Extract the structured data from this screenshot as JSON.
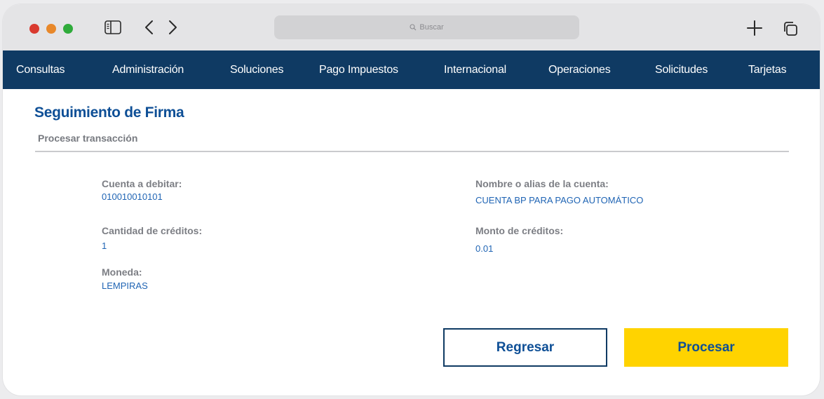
{
  "browser": {
    "search_placeholder": "Buscar"
  },
  "nav": {
    "items": [
      {
        "label": "Consultas"
      },
      {
        "label": "Administración"
      },
      {
        "label": "Soluciones"
      },
      {
        "label": "Pago Impuestos"
      },
      {
        "label": "Internacional"
      },
      {
        "label": "Operaciones"
      },
      {
        "label": "Solicitudes"
      },
      {
        "label": "Tarjetas"
      }
    ]
  },
  "page": {
    "title": "Seguimiento de Firma",
    "subtitle": "Procesar transacción"
  },
  "fields": {
    "cuenta_debitar": {
      "label": "Cuenta a debitar:",
      "value": "010010010101"
    },
    "nombre_alias": {
      "label": "Nombre o alias de la cuenta:",
      "value": "CUENTA BP PARA PAGO AUTOMÁTICO"
    },
    "cantidad_creditos": {
      "label": "Cantidad de créditos:",
      "value": "1"
    },
    "monto_creditos": {
      "label": "Monto de créditos:",
      "value": "0.01"
    },
    "moneda": {
      "label": "Moneda:",
      "value": "LEMPIRAS"
    }
  },
  "actions": {
    "back_label": "Regresar",
    "process_label": "Procesar"
  },
  "colors": {
    "nav_bg": "#0f3a63",
    "title": "#0e4f96",
    "value_text": "#1f64b4",
    "primary_button": "#ffd300"
  }
}
